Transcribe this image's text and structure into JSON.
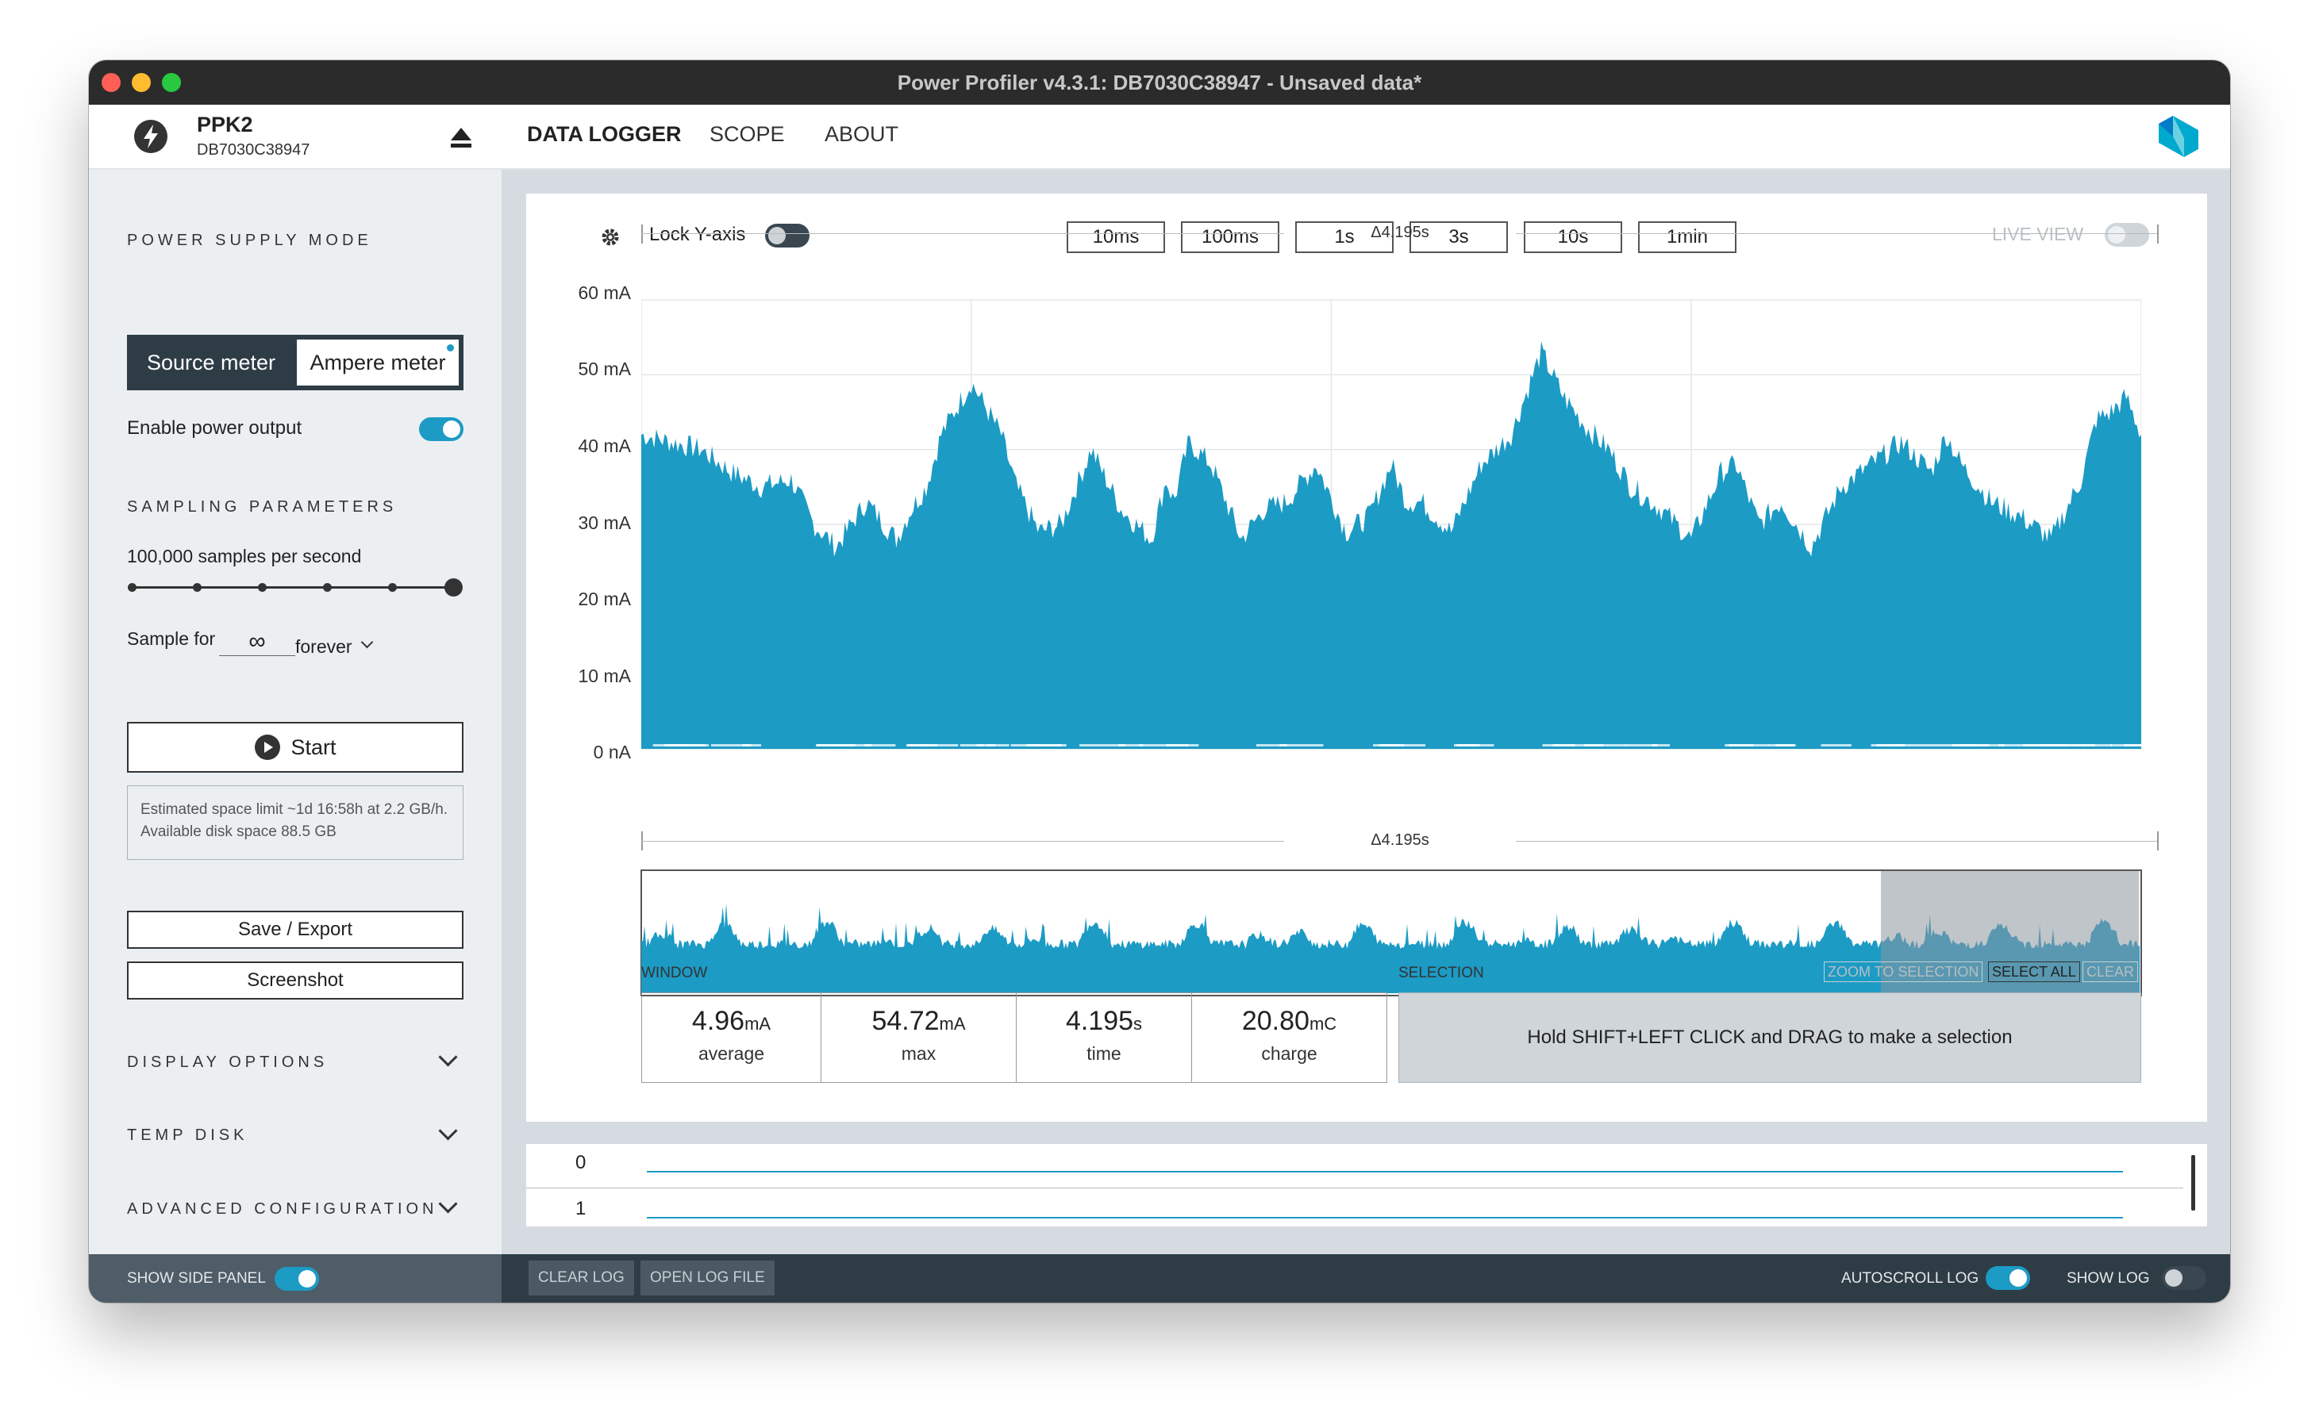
{
  "window": {
    "title": "Power Profiler v4.3.1: DB7030C38947 - Unsaved data*",
    "traffic_colors": [
      "#ff5f57",
      "#febc2e",
      "#28c840"
    ]
  },
  "device": {
    "name": "PPK2",
    "serial": "DB7030C38947",
    "icon": "lightning-bolt-icon",
    "eject_icon": "eject-icon"
  },
  "nav": {
    "tabs": [
      "DATA LOGGER",
      "SCOPE",
      "ABOUT"
    ],
    "active": "DATA LOGGER",
    "logo_icon": "nordic-logo-icon"
  },
  "sidebar": {
    "power_supply_mode": {
      "heading": "POWER SUPPLY MODE",
      "source_meter": "Source meter",
      "ampere_meter": "Ampere meter",
      "selected": "Ampere meter"
    },
    "enable_power_output": {
      "label": "Enable power output",
      "on": true
    },
    "sampling": {
      "heading": "SAMPLING PARAMETERS",
      "rate_label": "100,000 samples per second",
      "slider_steps": 6,
      "slider_value_index": 5,
      "sample_for_label": "Sample for",
      "duration_symbol": "∞",
      "duration_unit": "forever"
    },
    "start_button": "Start",
    "estimate_text": "Estimated space limit ~1d 16:58h at 2.2 GB/h. Available disk space 88.5 GB",
    "save_export": "Save / Export",
    "screenshot": "Screenshot",
    "collapsibles": [
      "DISPLAY OPTIONS",
      "TEMP DISK",
      "ADVANCED CONFIGURATION"
    ]
  },
  "toolbar": {
    "lock_y_axis": "Lock Y-axis",
    "lock_y_on": false,
    "time_buttons": [
      "10ms",
      "100ms",
      "1s",
      "3s",
      "10s",
      "1min"
    ],
    "live_view": "LIVE VIEW",
    "live_view_on": false
  },
  "chart_data": {
    "type": "area",
    "ylabel": "",
    "ylim": [
      0,
      60
    ],
    "y_ticks": [
      "60 mA",
      "50 mA",
      "40 mA",
      "30 mA",
      "20 mA",
      "10 mA",
      "0 nA"
    ],
    "duration_label": "Δ4.195s",
    "color": "#1c9bc5",
    "series": [
      {
        "x_fraction": [
          0,
          0.02,
          0.04,
          0.06,
          0.08,
          0.1,
          0.115,
          0.13,
          0.15,
          0.17,
          0.18,
          0.19,
          0.2,
          0.22,
          0.24,
          0.25,
          0.265,
          0.28,
          0.3,
          0.32,
          0.34,
          0.35,
          0.355,
          0.365,
          0.38,
          0.4,
          0.415,
          0.43,
          0.45,
          0.47,
          0.485,
          0.5,
          0.51,
          0.52,
          0.54,
          0.56,
          0.58,
          0.6,
          0.615,
          0.63,
          0.645,
          0.66,
          0.68,
          0.7,
          0.72,
          0.73,
          0.745,
          0.76,
          0.76,
          0.78,
          0.8,
          0.82,
          0.84,
          0.86,
          0.87,
          0.88,
          0.9,
          0.92,
          0.94,
          0.96,
          0.97,
          0.98,
          0.99,
          1.0
        ],
        "values": [
          42,
          41,
          40,
          37,
          35,
          36,
          30,
          27,
          33,
          28,
          32,
          35,
          42,
          49,
          42,
          35,
          29,
          30,
          40,
          32,
          28,
          36,
          33,
          41,
          38,
          28,
          32,
          33,
          38,
          29,
          31,
          38,
          33,
          33,
          29,
          38,
          42,
          53,
          47,
          43,
          40,
          35,
          32,
          28,
          37,
          38,
          30,
          33,
          33,
          27,
          35,
          38,
          41,
          37,
          42,
          38,
          33,
          31,
          28,
          36,
          44,
          45,
          47,
          42
        ]
      }
    ],
    "baseline_gaps": "near-zero dips along 0 nA"
  },
  "overview": {
    "selection_start_fraction": 0.827
  },
  "window_stats": {
    "heading": "WINDOW",
    "items": [
      {
        "value": "4.96",
        "unit": "mA",
        "label": "average"
      },
      {
        "value": "54.72",
        "unit": "mA",
        "label": "max"
      },
      {
        "value": "4.195",
        "unit": "s",
        "label": "time"
      },
      {
        "value": "20.80",
        "unit": "mC",
        "label": "charge"
      }
    ]
  },
  "selection": {
    "heading": "SELECTION",
    "zoom_to_selection": "ZOOM TO SELECTION",
    "select_all": "SELECT ALL",
    "clear": "CLEAR",
    "hint": "Hold SHIFT+LEFT CLICK and DRAG to make a selection"
  },
  "digital_channels": [
    "0",
    "1"
  ],
  "footer": {
    "show_side_panel": "SHOW SIDE PANEL",
    "show_side_panel_on": true,
    "clear_log": "CLEAR LOG",
    "open_log_file": "OPEN LOG FILE",
    "autoscroll_log": "AUTOSCROLL LOG",
    "autoscroll_on": true,
    "show_log": "SHOW LOG",
    "show_log_on": false
  }
}
